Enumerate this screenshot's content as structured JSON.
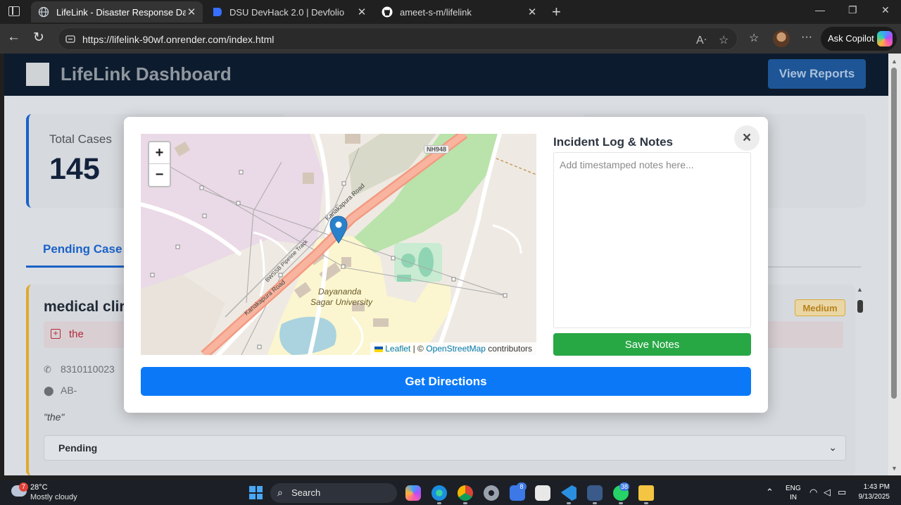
{
  "browser": {
    "tabs": [
      {
        "title": "LifeLink - Disaster Response Dash",
        "active": true
      },
      {
        "title": "DSU DevHack 2.0 | Devfolio",
        "active": false
      },
      {
        "title": "ameet-s-m/lifelink",
        "active": false
      }
    ],
    "url": "https://lifelink-90wf.onrender.com/index.html",
    "copilot_label": "Ask Copilot"
  },
  "app": {
    "title": "LifeLink Dashboard",
    "view_reports": "View Reports",
    "stats": {
      "total_label": "Total Cases",
      "total_value": "145"
    },
    "pending_tab": "Pending Case",
    "case": {
      "title": "medical clir",
      "priority": "Medium",
      "tag": "the",
      "phone": "8310110023",
      "address": "AB-",
      "quote": "\"the\"",
      "status": "Pending"
    }
  },
  "modal": {
    "notes_title": "Incident Log & Notes",
    "notes_placeholder": "Add timestamped notes here...",
    "save_label": "Save Notes",
    "close_symbol": "×",
    "directions_label": "Get Directions",
    "map": {
      "zoom_in": "+",
      "zoom_out": "−",
      "attribution_leaflet": "Leaflet",
      "attribution_sep": "| ©",
      "attribution_osm": "OpenStreetMap",
      "attribution_tail": "contributors",
      "labels": {
        "highway": "NH948",
        "road_top": "Kanakapura Road",
        "road_bottom": "Kanakapura Road",
        "track": "BWSSB Pipeline Track",
        "campus_line1": "Dayananda",
        "campus_line2": "Sagar University"
      }
    }
  },
  "taskbar": {
    "weather_badge": "7",
    "temperature": "28°C",
    "weather": "Mostly cloudy",
    "search_label": "Search",
    "teams_badge": "8",
    "whatsapp_badge": "38",
    "lang_top": "ENG",
    "lang_bottom": "IN",
    "time": "1:43 PM",
    "date": "9/13/2025"
  },
  "colors": {
    "accent": "#0b79f7",
    "save_green": "#28a745",
    "header_navy": "#0d1b2e",
    "marker_blue": "#2a81cb"
  }
}
